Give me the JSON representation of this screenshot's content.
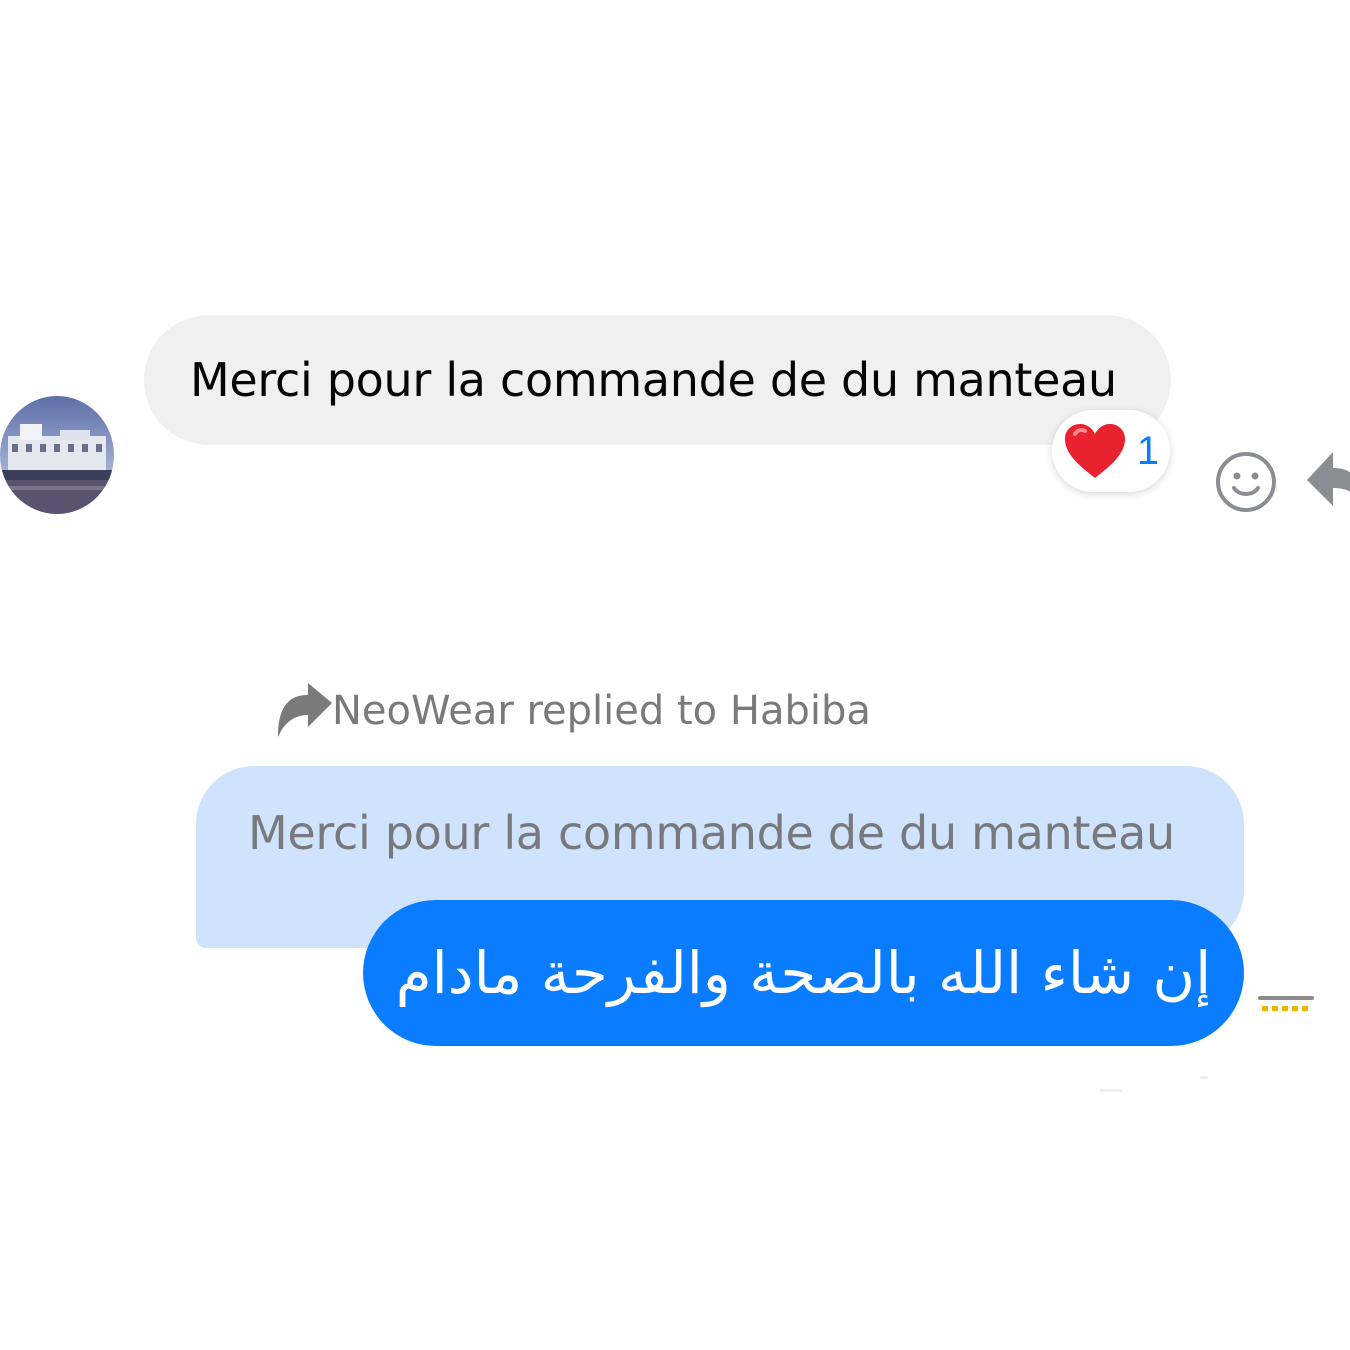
{
  "incoming": {
    "message": "Merci pour la commande de du manteau",
    "reaction": {
      "emoji": "heart",
      "count": "1"
    }
  },
  "reply": {
    "header": "NeoWear replied to Habiba",
    "quoted_message": "Merci pour la commande de du manteau",
    "message": "إن شاء الله بالصحة والفرحة مادام"
  },
  "colors": {
    "incoming_bubble": "#f0f0f0",
    "quoted_bubble": "#cfe3fd",
    "outgoing_bubble": "#0a7cff",
    "reaction_count": "#0a7cff",
    "heart": "#e8222e"
  },
  "icons": {
    "reaction_action": "smiley-icon",
    "reply_action": "reply-icon",
    "reply_header": "reply-arrow-icon"
  }
}
